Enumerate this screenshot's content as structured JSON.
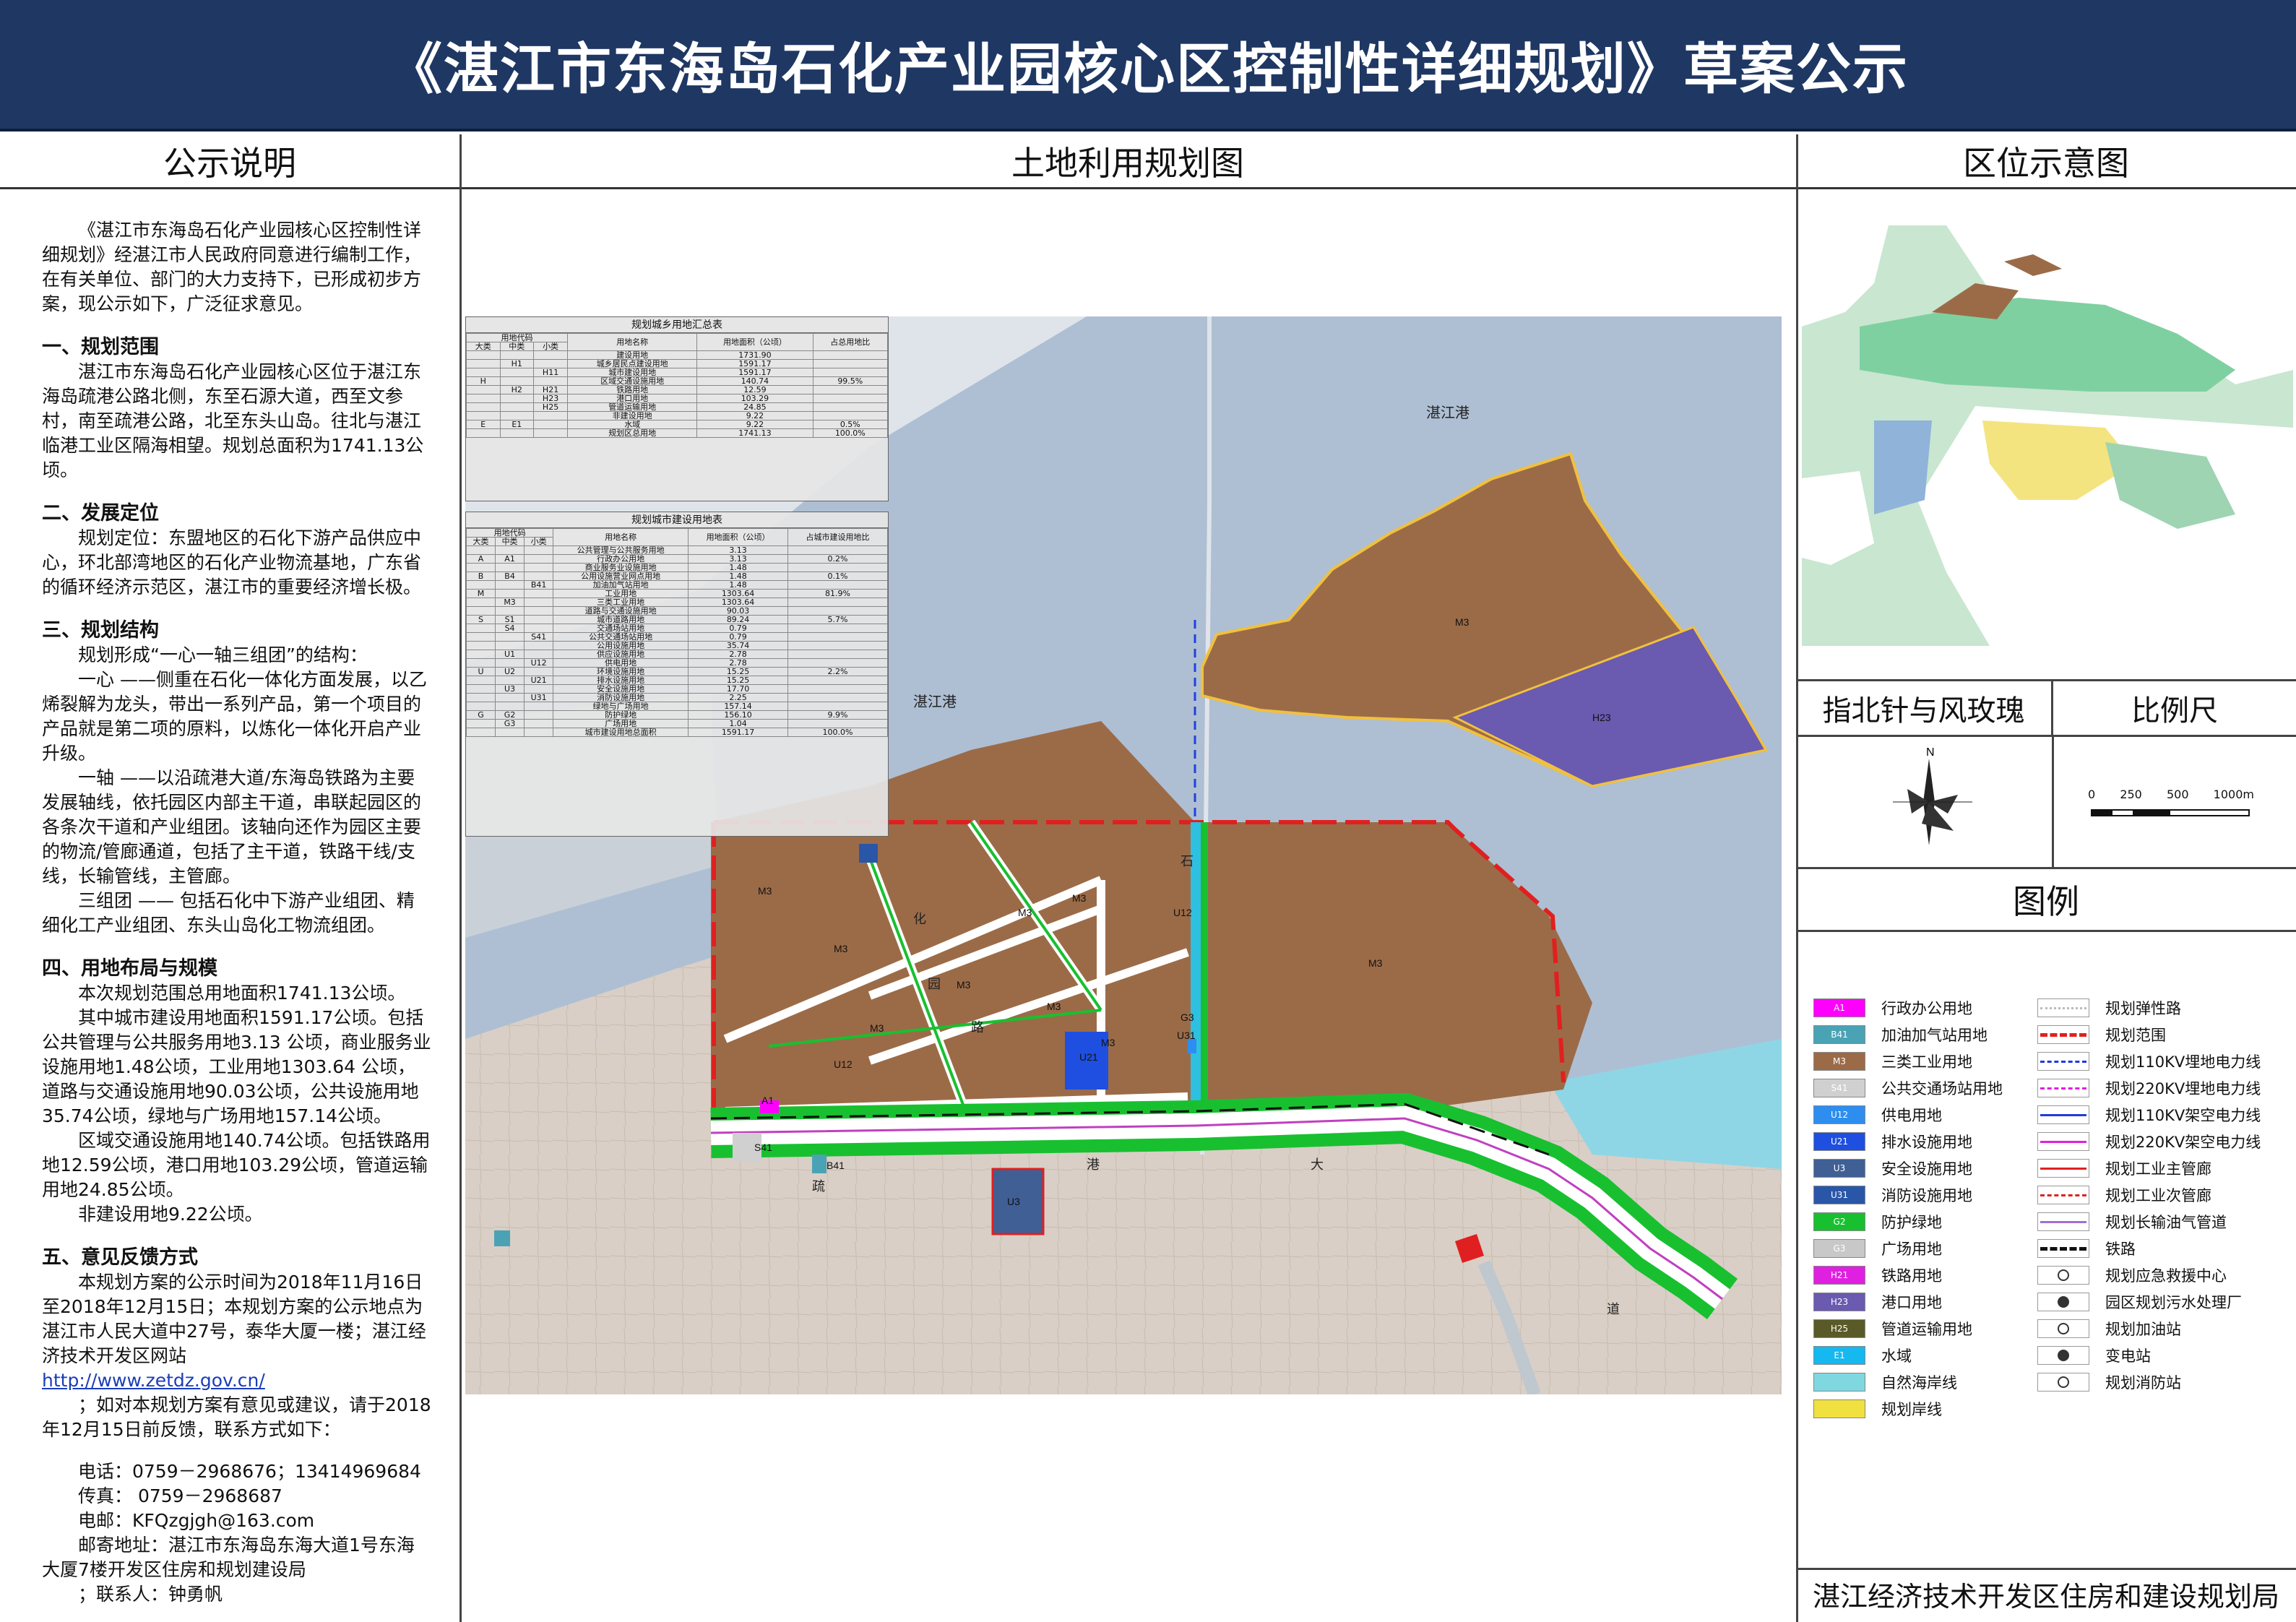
{
  "header": {
    "title": "《湛江市东海岛石化产业园核心区控制性详细规划》草案公示"
  },
  "columns": {
    "left": "公示说明",
    "center": "土地利用规划图",
    "right": "区位示意图"
  },
  "notes": {
    "intro": "《湛江市东海岛石化产业园核心区控制性详细规划》经湛江市人民政府同意进行编制工作，在有关单位、部门的大力支持下，已形成初步方案，现公示如下，广泛征求意见。",
    "s1_title": "一、规划范围",
    "s1_text": "湛江市东海岛石化产业园核心区位于湛江东海岛疏港公路北侧，东至石源大道，西至文参村，南至疏港公路，北至东头山岛。往北与湛江临港工业区隔海相望。规划总面积为1741.13公顷。",
    "s2_title": "二、发展定位",
    "s2_text": "规划定位：东盟地区的石化下游产品供应中心，环北部湾地区的石化产业物流基地，广东省的循环经济示范区，湛江市的重要经济增长极。",
    "s3_title": "三、规划结构",
    "s3_text1": "规划形成“一心一轴三组团”的结构：",
    "s3_text2": "一心 ——侧重在石化一体化方面发展，以乙烯裂解为龙头，带出一系列产品，第一个项目的产品就是第二项的原料，以炼化一体化开启产业升级。",
    "s3_text3": "一轴 ——以沿疏港大道/东海岛铁路为主要发展轴线，依托园区内部主干道，串联起园区的各条次干道和产业组团。该轴向还作为园区主要的物流/管廊通道，包括了主干道，铁路干线/支线，长输管线，主管廊。",
    "s3_text4": "三组团 —— 包括石化中下游产业组团、精细化工产业组团、东头山岛化工物流组团。",
    "s4_title": "四、用地布局与规模",
    "s4_text1": "本次规划范围总用地面积1741.13公顷。",
    "s4_text2": "其中城市建设用地面积1591.17公顷。包括公共管理与公共服务用地3.13 公顷，商业服务业设施用地1.48公顷，工业用地1303.64 公顷，道路与交通设施用地90.03公顷，公共设施用地35.74公顷，绿地与广场用地157.14公顷。",
    "s4_text3": "区域交通设施用地140.74公顷。包括铁路用地12.59公顷，港口用地103.29公顷，管道运输用地24.85公顷。",
    "s4_text4": "非建设用地9.22公顷。",
    "s5_title": "五、意见反馈方式",
    "s5_text1": "本规划方案的公示时间为2018年11月16日至2018年12月15日；本规划方案的公示地点为湛江市人民大道中27号，泰华大厦一楼；湛江经济技术开发区网站",
    "s5_link": "http://www.zetdz.gov.cn/",
    "s5_text2": "；如对本规划方案有意见或建议，请于2018年12月15日前反馈，联系方式如下：",
    "phone": "电话：0759－2968676；13414969684",
    "fax": "传真： 0759－2968687",
    "email": "电邮：KFQzgjgh@163.com",
    "address": "邮寄地址：湛江市东海岛东海大道1号东海大厦7楼开发区住房和规划建设局",
    "contact": "；联系人：钟勇帆"
  },
  "map": {
    "labels": {
      "port_ne": "湛江港",
      "port_w": "湛江港"
    },
    "zones": [
      "M3",
      "M3",
      "M3",
      "M3",
      "M3",
      "M3",
      "M3",
      "M3",
      "M3",
      "H23",
      "U21",
      "U3",
      "U12",
      "U31",
      "S41",
      "B41",
      "A1",
      "G3",
      "U12"
    ],
    "roads": [
      "疏",
      "港",
      "大",
      "道",
      "石",
      "化",
      "园",
      "路"
    ]
  },
  "table1": {
    "title": "规划城乡用地汇总表",
    "head": [
      "用地代码",
      "用地名称",
      "用地面积（公顷）",
      "占总用地比"
    ],
    "sub": [
      "大类",
      "中类",
      "小类"
    ],
    "rows": [
      [
        "",
        "",
        "",
        "建设用地",
        "1731.90",
        ""
      ],
      [
        "",
        "H1",
        "",
        "城乡居民点建设用地",
        "1591.17",
        ""
      ],
      [
        "",
        "",
        "H11",
        "城市建设用地",
        "1591.17",
        ""
      ],
      [
        "H",
        "",
        "",
        "区域交通设施用地",
        "140.74",
        "99.5%"
      ],
      [
        "",
        "H2",
        "H21",
        "铁路用地",
        "12.59",
        ""
      ],
      [
        "",
        "",
        "H23",
        "港口用地",
        "103.29",
        ""
      ],
      [
        "",
        "",
        "H25",
        "管道运输用地",
        "24.85",
        ""
      ],
      [
        "",
        "",
        "",
        "非建设用地",
        "9.22",
        ""
      ],
      [
        "E",
        "E1",
        "",
        "水域",
        "9.22",
        "0.5%"
      ],
      [
        "",
        "",
        "",
        "规划区总用地",
        "1741.13",
        "100.0%"
      ]
    ]
  },
  "table2": {
    "title": "规划城市建设用地表",
    "head": [
      "用地代码",
      "用地名称",
      "用地面积（公顷）",
      "占城市建设用地比"
    ],
    "sub": [
      "大类",
      "中类",
      "小类"
    ],
    "rows": [
      [
        "",
        "",
        "",
        "公共管理与公共服务用地",
        "3.13",
        ""
      ],
      [
        "A",
        "A1",
        "",
        "行政办公用地",
        "3.13",
        "0.2%"
      ],
      [
        "",
        "",
        "",
        "商业服务业设施用地",
        "1.48",
        ""
      ],
      [
        "B",
        "B4",
        "",
        "公用设施营业网点用地",
        "1.48",
        "0.1%"
      ],
      [
        "",
        "",
        "B41",
        "加油加气站用地",
        "1.48",
        ""
      ],
      [
        "M",
        "",
        "",
        "工业用地",
        "1303.64",
        "81.9%"
      ],
      [
        "",
        "M3",
        "",
        "三类工业用地",
        "1303.64",
        ""
      ],
      [
        "",
        "",
        "",
        "道路与交通设施用地",
        "90.03",
        ""
      ],
      [
        "S",
        "S1",
        "",
        "城市道路用地",
        "89.24",
        "5.7%"
      ],
      [
        "",
        "S4",
        "",
        "交通场站用地",
        "0.79",
        ""
      ],
      [
        "",
        "",
        "S41",
        "公共交通场站用地",
        "0.79",
        ""
      ],
      [
        "",
        "",
        "",
        "公用设施用地",
        "35.74",
        ""
      ],
      [
        "",
        "U1",
        "",
        "供应设施用地",
        "2.78",
        ""
      ],
      [
        "",
        "",
        "U12",
        "供电用地",
        "2.78",
        ""
      ],
      [
        "U",
        "U2",
        "",
        "环境设施用地",
        "15.25",
        "2.2%"
      ],
      [
        "",
        "",
        "U21",
        "排水设施用地",
        "15.25",
        ""
      ],
      [
        "",
        "U3",
        "",
        "安全设施用地",
        "17.70",
        ""
      ],
      [
        "",
        "",
        "U31",
        "消防设施用地",
        "2.25",
        ""
      ],
      [
        "",
        "",
        "",
        "绿地与广场用地",
        "157.14",
        ""
      ],
      [
        "G",
        "G2",
        "",
        "防护绿地",
        "156.10",
        "9.9%"
      ],
      [
        "",
        "G3",
        "",
        "广场用地",
        "1.04",
        ""
      ],
      [
        "",
        "",
        "",
        "城市建设用地总面积",
        "1591.17",
        "100.0%"
      ]
    ]
  },
  "compass": {
    "title": "指北针与风玫瑰",
    "north": "N"
  },
  "scale": {
    "title": "比例尺",
    "ticks": [
      "0",
      "250",
      "500",
      "1000m"
    ]
  },
  "legend": {
    "title": "图例",
    "left": [
      {
        "code": "A1",
        "label": "行政办公用地",
        "color": "#ff00ff"
      },
      {
        "code": "B41",
        "label": "加油加气站用地",
        "color": "#4aa3b5"
      },
      {
        "code": "M3",
        "label": "三类工业用地",
        "color": "#9b6b48"
      },
      {
        "code": "S41",
        "label": "公共交通场站用地",
        "color": "#d0d0d0"
      },
      {
        "code": "U12",
        "label": "供电用地",
        "color": "#2d8ef0"
      },
      {
        "code": "U21",
        "label": "排水设施用地",
        "color": "#1f4fe0"
      },
      {
        "code": "U3",
        "label": "安全设施用地",
        "color": "#3f5f95"
      },
      {
        "code": "U31",
        "label": "消防设施用地",
        "color": "#2a56a8"
      },
      {
        "code": "G2",
        "label": "防护绿地",
        "color": "#18c030"
      },
      {
        "code": "G3",
        "label": "广场用地",
        "color": "#c8c8c8"
      },
      {
        "code": "H21",
        "label": "铁路用地",
        "color": "#e020e0"
      },
      {
        "code": "H23",
        "label": "港口用地",
        "color": "#6a5ab0"
      },
      {
        "code": "H25",
        "label": "管道运输用地",
        "color": "#5a5a28"
      },
      {
        "code": "E1",
        "label": "水域",
        "color": "#16b8f0"
      },
      {
        "code": "",
        "label": "自然海岸线",
        "color": "#7fd8e0"
      },
      {
        "code": "",
        "label": "规划岸线",
        "color": "#f0e040"
      }
    ],
    "right": [
      {
        "label": "规划弹性路"
      },
      {
        "label": "规划范围"
      },
      {
        "label": "规划110KV埋地电力线"
      },
      {
        "label": "规划220KV埋地电力线"
      },
      {
        "label": "规划110KV架空电力线"
      },
      {
        "label": "规划220KV架空电力线"
      },
      {
        "label": "规划工业主管廊"
      },
      {
        "label": "规划工业次管廊"
      },
      {
        "label": "规划长输油气管道"
      },
      {
        "label": "铁路"
      },
      {
        "label": "规划应急救援中心"
      },
      {
        "label": "园区规划污水处理厂"
      },
      {
        "label": "规划加油站"
      },
      {
        "label": "变电站"
      },
      {
        "label": "规划消防站"
      }
    ]
  },
  "footer": {
    "org": "湛江经济技术开发区住房和建设规划局"
  }
}
